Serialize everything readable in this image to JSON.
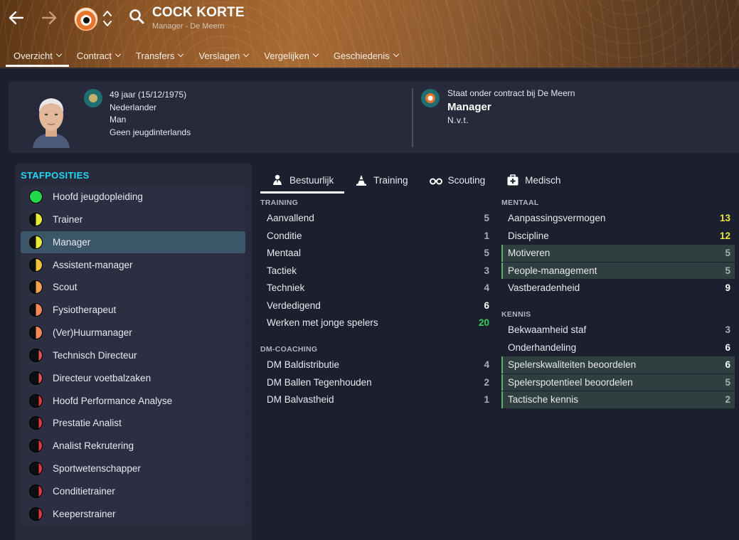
{
  "header": {
    "title": "COCK KORTE",
    "subtitle": "Manager - De Meern",
    "menu": [
      {
        "label": "Overzicht"
      },
      {
        "label": "Contract"
      },
      {
        "label": "Transfers"
      },
      {
        "label": "Verslagen"
      },
      {
        "label": "Vergelijken"
      },
      {
        "label": "Geschiedenis"
      }
    ]
  },
  "profile": {
    "age": "49 jaar (15/12/1975)",
    "nationality": "Nederlander",
    "gender": "Man",
    "youth": "Geen jeugdinterlands",
    "contract_line": "Staat onder contract bij De Meern",
    "role": "Manager",
    "role_sub": "N.v.t."
  },
  "positions": {
    "title": "STAFPOSITIES",
    "items": [
      {
        "label": "Hoofd jeugdopleiding",
        "color": "#22d84a",
        "fill": 1.0
      },
      {
        "label": "Trainer",
        "color": "#e8e83a",
        "fill": 0.5
      },
      {
        "label": "Manager",
        "color": "#e8e83a",
        "fill": 0.5
      },
      {
        "label": "Assistent-manager",
        "color": "#f0c040",
        "fill": 0.5
      },
      {
        "label": "Scout",
        "color": "#f0a050",
        "fill": 0.5
      },
      {
        "label": "Fysiotherapeut",
        "color": "#f08858",
        "fill": 0.5
      },
      {
        "label": "(Ver)Huurmanager",
        "color": "#f08858",
        "fill": 0.5
      },
      {
        "label": "Technisch Directeur",
        "color": "#e85050",
        "fill": 0.25
      },
      {
        "label": "Directeur voetbalzaken",
        "color": "#e85050",
        "fill": 0.25
      },
      {
        "label": "Hoofd Performance Analyse",
        "color": "#e03a3a",
        "fill": 0.25
      },
      {
        "label": "Prestatie Analist",
        "color": "#e03a3a",
        "fill": 0.25
      },
      {
        "label": "Analist Rekrutering",
        "color": "#e03a3a",
        "fill": 0.25
      },
      {
        "label": "Sportwetenschapper",
        "color": "#e03a3a",
        "fill": 0.25
      },
      {
        "label": "Conditietrainer",
        "color": "#e03a3a",
        "fill": 0.25
      },
      {
        "label": "Keeperstrainer",
        "color": "#e03a3a",
        "fill": 0.25
      }
    ],
    "selected_index": 2
  },
  "tabs": [
    {
      "label": "Bestuurlijk",
      "icon": "person-icon"
    },
    {
      "label": "Training",
      "icon": "cone-icon"
    },
    {
      "label": "Scouting",
      "icon": "binoculars-icon"
    },
    {
      "label": "Medisch",
      "icon": "medkit-icon"
    }
  ],
  "attributes": {
    "training": {
      "title": "TRAINING",
      "items": [
        {
          "label": "Aanvallend",
          "value": "5"
        },
        {
          "label": "Conditie",
          "value": "1"
        },
        {
          "label": "Mentaal",
          "value": "5"
        },
        {
          "label": "Tactiek",
          "value": "3"
        },
        {
          "label": "Techniek",
          "value": "4"
        },
        {
          "label": "Verdedigend",
          "value": "6"
        },
        {
          "label": "Werken met jonge spelers",
          "value": "20"
        }
      ]
    },
    "dm_coaching": {
      "title": "DM-COACHING",
      "items": [
        {
          "label": "DM Baldistributie",
          "value": "4"
        },
        {
          "label": "DM Ballen Tegenhouden",
          "value": "2"
        },
        {
          "label": "DM Balvastheid",
          "value": "1"
        }
      ]
    },
    "mentaal": {
      "title": "MENTAAL",
      "items": [
        {
          "label": "Aanpassingsvermogen",
          "value": "13"
        },
        {
          "label": "Discipline",
          "value": "12"
        },
        {
          "label": "Motiveren",
          "value": "5",
          "key": true
        },
        {
          "label": "People-management",
          "value": "5",
          "key": true
        },
        {
          "label": "Vastberadenheid",
          "value": "9"
        }
      ]
    },
    "kennis": {
      "title": "KENNIS",
      "items": [
        {
          "label": "Bekwaamheid staf",
          "value": "3"
        },
        {
          "label": "Onderhandeling",
          "value": "6"
        },
        {
          "label": "Spelerskwaliteiten beoordelen",
          "value": "6",
          "key": true
        },
        {
          "label": "Spelerspotentieel beoordelen",
          "value": "5",
          "key": true
        },
        {
          "label": "Tactische kennis",
          "value": "2",
          "key": true
        }
      ]
    }
  }
}
